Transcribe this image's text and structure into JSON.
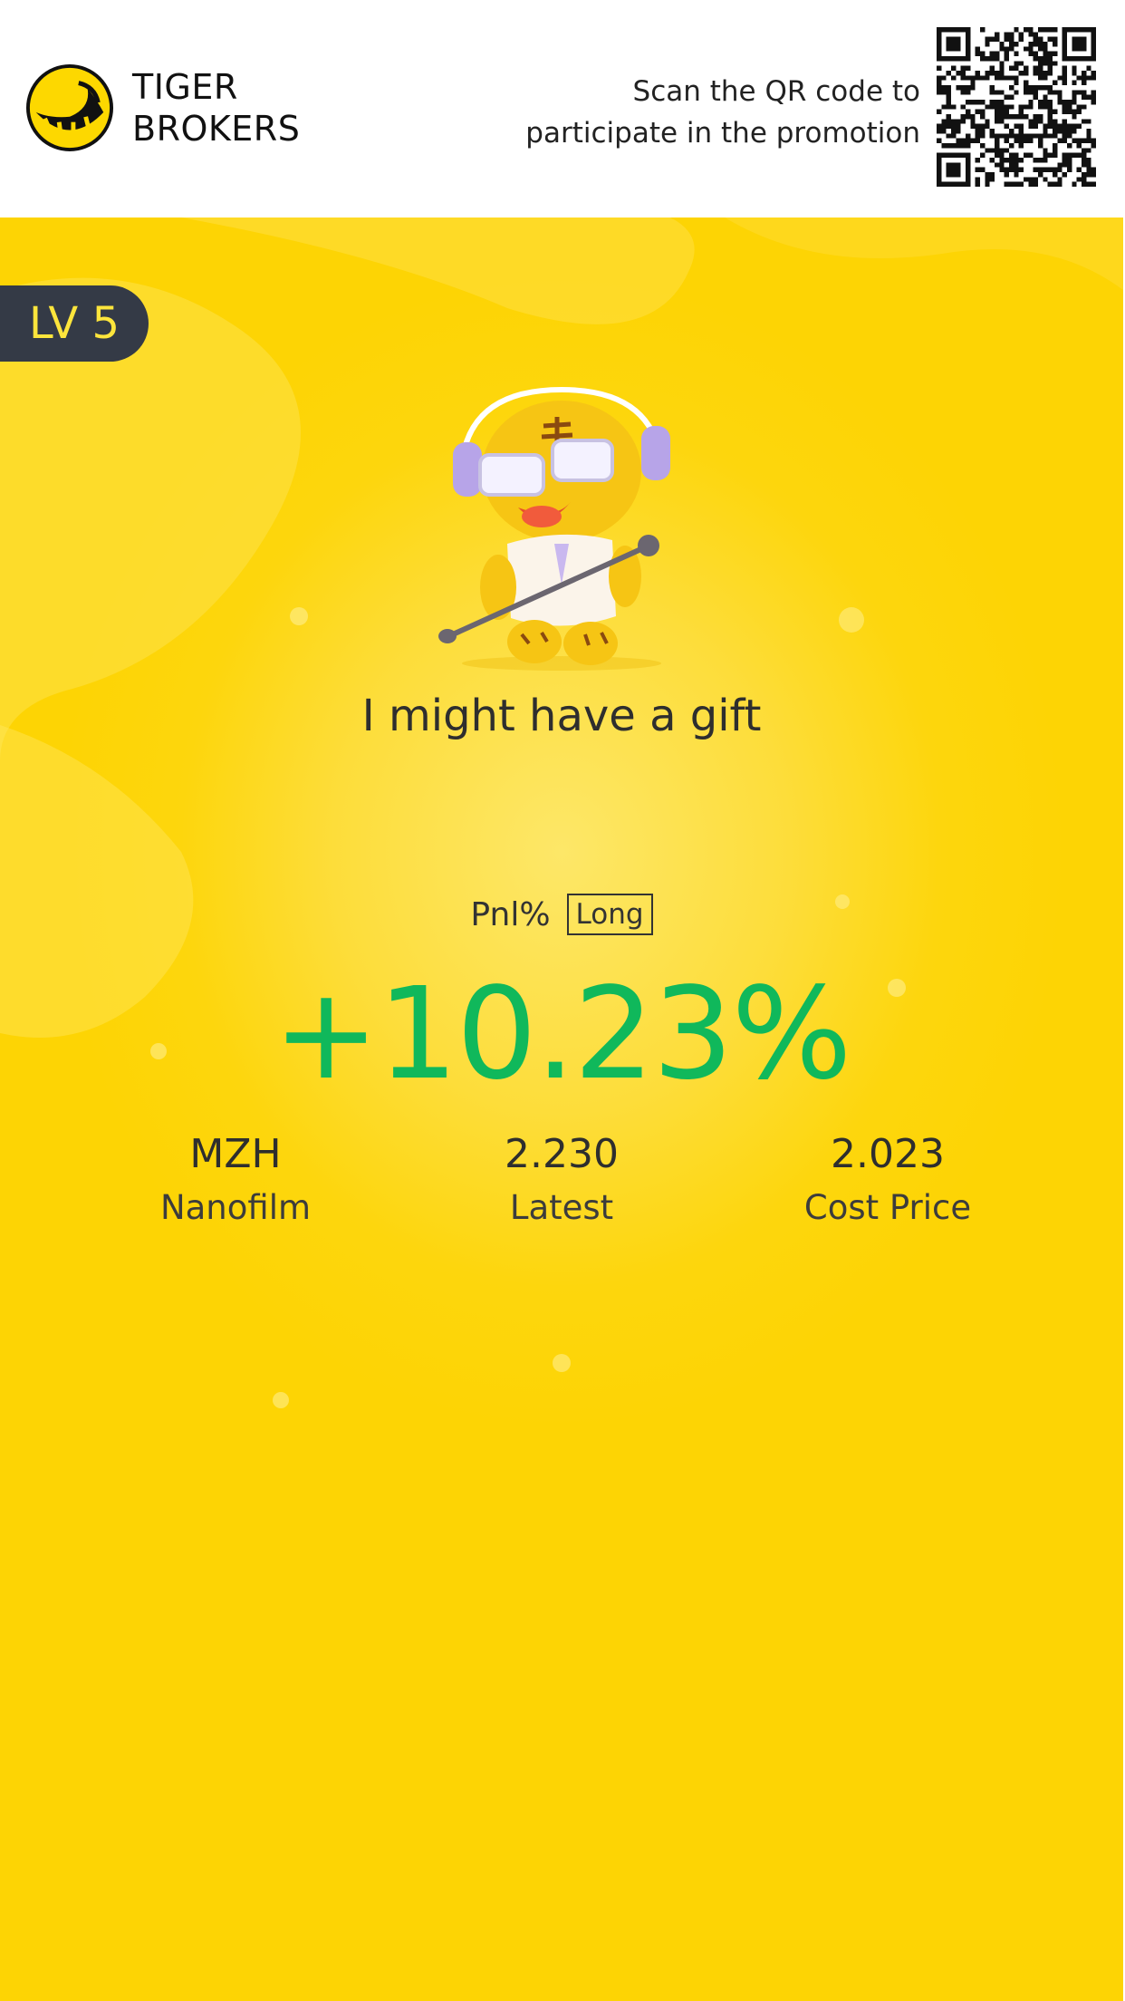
{
  "header": {
    "brand_line1": "TIGER",
    "brand_line2": "BROKERS",
    "promo_line1": "Scan the QR code to",
    "promo_line2": "participate in the promotion",
    "logo_icon": "tiger-stripe-logo",
    "qr_icon": "qr-code"
  },
  "card": {
    "level": "LV 5",
    "mascot_icon": "tiger-mascot-singing",
    "tagline": "I might have a gift",
    "pnl_label": "Pnl%",
    "position_type": "Long",
    "pnl_value": "+10.23%",
    "pnl_color": "#10b85b",
    "background_color": "#fdd404",
    "stats": [
      {
        "value": "MZH",
        "label": "Nanofilm"
      },
      {
        "value": "2.230",
        "label": "Latest"
      },
      {
        "value": "2.023",
        "label": "Cost Price"
      }
    ]
  }
}
